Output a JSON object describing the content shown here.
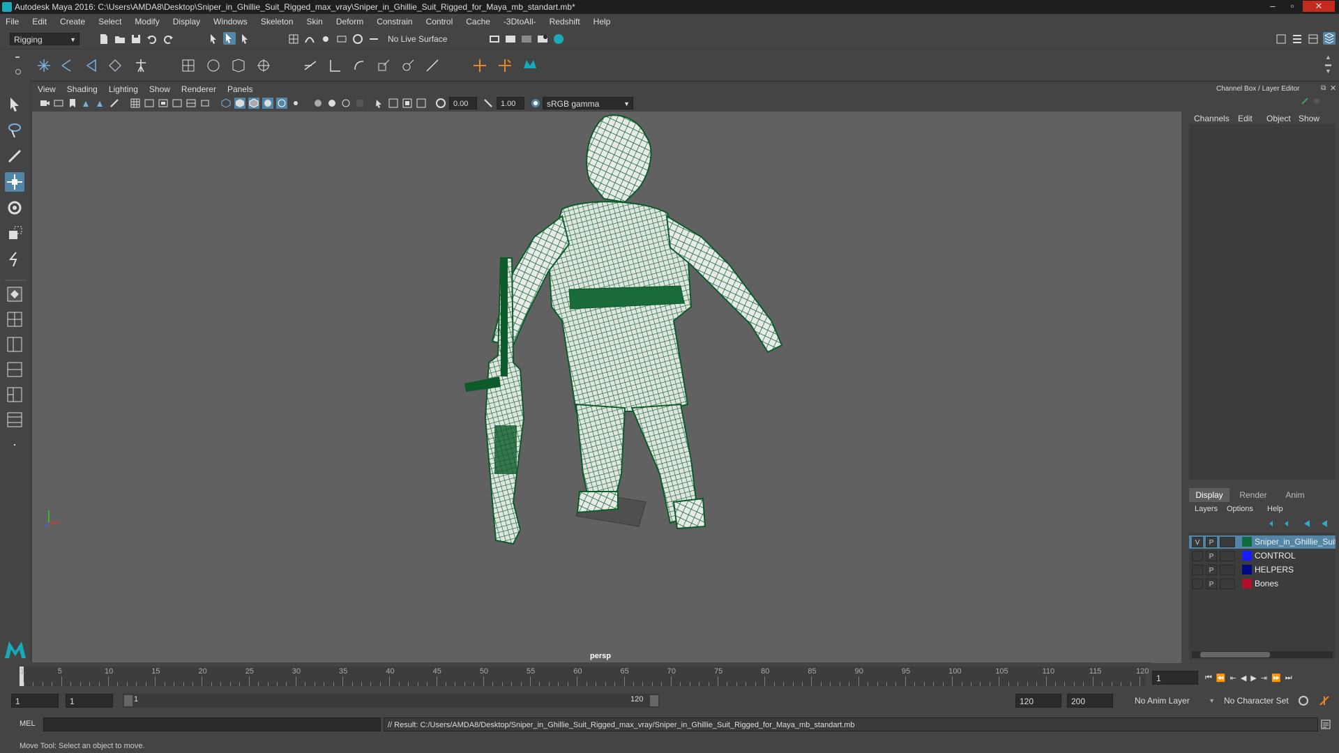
{
  "window": {
    "title": "Autodesk Maya 2016: C:\\Users\\AMDA8\\Desktop\\Sniper_in_Ghillie_Suit_Rigged_max_vray\\Sniper_in_Ghillie_Suit_Rigged_for_Maya_mb_standart.mb*"
  },
  "menubar": [
    "File",
    "Edit",
    "Create",
    "Select",
    "Modify",
    "Display",
    "Windows",
    "Skeleton",
    "Skin",
    "Deform",
    "Constrain",
    "Control",
    "Cache",
    "-3DtoAll-",
    "Redshift",
    "Help"
  ],
  "statusline": {
    "mode": "Rigging",
    "live_surface": "No Live Surface"
  },
  "panel_menu": [
    "View",
    "Shading",
    "Lighting",
    "Show",
    "Renderer",
    "Panels"
  ],
  "view_toolbar": {
    "exposure": "0.00",
    "gamma": "1.00",
    "color_space": "sRGB gamma"
  },
  "viewport": {
    "camera_label": "persp",
    "mesh_color": "#0d5a2a",
    "background": "#616161"
  },
  "channel_box": {
    "title": "Channel Box / Layer Editor",
    "menu": [
      "Channels",
      "Edit",
      "Object",
      "Show"
    ]
  },
  "layer_editor": {
    "tabs": [
      "Display",
      "Render",
      "Anim"
    ],
    "active_tab": "Display",
    "menu": [
      "Layers",
      "Options",
      "Help"
    ],
    "layers": [
      {
        "v": "V",
        "p": "P",
        "name": "Sniper_in_Ghillie_Suit",
        "color": "#0f6b3a",
        "selected": true
      },
      {
        "v": "",
        "p": "P",
        "name": "CONTROL",
        "color": "#1a1aff",
        "selected": false
      },
      {
        "v": "",
        "p": "P",
        "name": "HELPERS",
        "color": "#000a80",
        "selected": false
      },
      {
        "v": "",
        "p": "P",
        "name": "Bones",
        "color": "#b0102a",
        "selected": false
      }
    ]
  },
  "time_slider": {
    "labels": [
      "1",
      "5",
      "10",
      "15",
      "20",
      "25",
      "30",
      "35",
      "40",
      "45",
      "50",
      "55",
      "60",
      "65",
      "70",
      "75",
      "80",
      "85",
      "90",
      "95",
      "100",
      "105",
      "110",
      "115",
      "120"
    ],
    "current_frame": "1"
  },
  "range_slider": {
    "start": "1",
    "playback_start": "1",
    "range_start_label": "1",
    "range_end_label": "120",
    "playback_end": "120",
    "end": "200",
    "anim_layer": "No Anim Layer",
    "character_set": "No Character Set"
  },
  "command_line": {
    "language": "MEL",
    "result": "// Result: C:/Users/AMDA8/Desktop/Sniper_in_Ghillie_Suit_Rigged_max_vray/Sniper_in_Ghillie_Suit_Rigged_for_Maya_mb_standart.mb"
  },
  "help_line": "Move Tool: Select an object to move."
}
